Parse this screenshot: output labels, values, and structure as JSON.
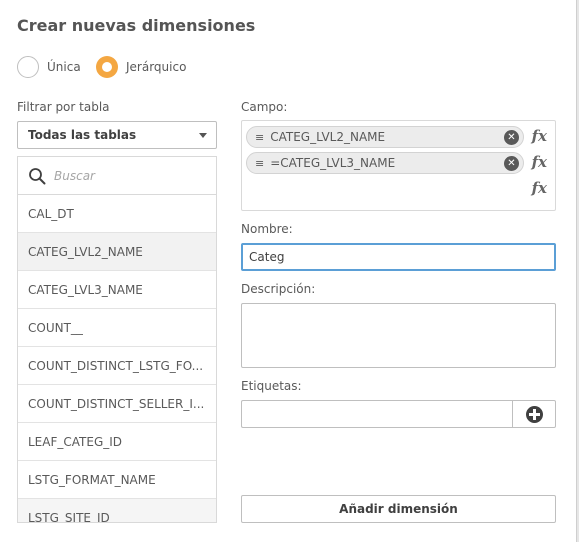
{
  "dialog": {
    "title": "Crear nuevas dimensiones"
  },
  "type_options": [
    {
      "label": "Única",
      "checked": false
    },
    {
      "label": "Jerárquico",
      "checked": true
    }
  ],
  "filter": {
    "label": "Filtrar por tabla",
    "selected": "Todas las tablas"
  },
  "search": {
    "placeholder": "Buscar",
    "value": ""
  },
  "fields": [
    "CAL_DT",
    "CATEG_LVL2_NAME",
    "CATEG_LVL3_NAME",
    "COUNT__",
    "COUNT_DISTINCT_LSTG_FO...",
    "COUNT_DISTINCT_SELLER_I...",
    "LEAF_CATEG_ID",
    "LSTG_FORMAT_NAME",
    "LSTG_SITE_ID"
  ],
  "campo": {
    "label": "Campo:",
    "chips": [
      {
        "drag_icon": "≡",
        "text": "CATEG_LVL2_NAME"
      },
      {
        "drag_icon": "≡",
        "text": "=CATEG_LVL3_NAME"
      }
    ],
    "fx_label": "fx"
  },
  "nombre": {
    "label": "Nombre:",
    "value": "Categ"
  },
  "descripcion": {
    "label": "Descripción:",
    "value": ""
  },
  "etiquetas": {
    "label": "Etiquetas:",
    "value": ""
  },
  "actions": {
    "add_label": "Añadir dimensión"
  },
  "colors": {
    "accent": "#f4a742",
    "focus": "#5b9fd6"
  }
}
